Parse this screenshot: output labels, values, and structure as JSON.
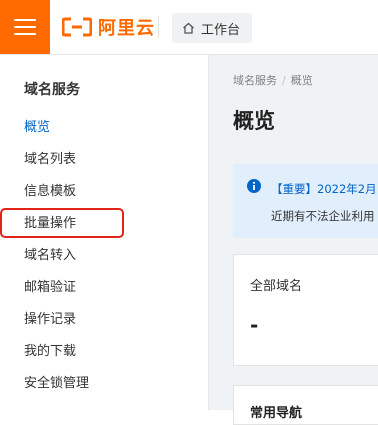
{
  "header": {
    "logo_text": "阿里云",
    "workbench_label": "工作台"
  },
  "sidebar": {
    "title": "域名服务",
    "items": [
      {
        "label": "概览",
        "active": true
      },
      {
        "label": "域名列表"
      },
      {
        "label": "信息模板"
      },
      {
        "label": "批量操作",
        "highlighted": true
      },
      {
        "label": "域名转入"
      },
      {
        "label": "邮箱验证"
      },
      {
        "label": "操作记录"
      },
      {
        "label": "我的下载"
      },
      {
        "label": "安全锁管理"
      }
    ]
  },
  "main": {
    "breadcrumb": [
      "域名服务",
      "概览"
    ],
    "title": "概览",
    "notice": {
      "line1": "【重要】2022年2月",
      "line2": "近期有不法企业利用"
    },
    "card_total": {
      "label": "全部域名",
      "value": "-"
    },
    "card_common": {
      "label": "常用导航"
    }
  },
  "colors": {
    "brand": "#ff6a00",
    "active_link": "#0064c8",
    "highlight_border": "#e2231a",
    "notice_bg": "#e1eefb"
  }
}
